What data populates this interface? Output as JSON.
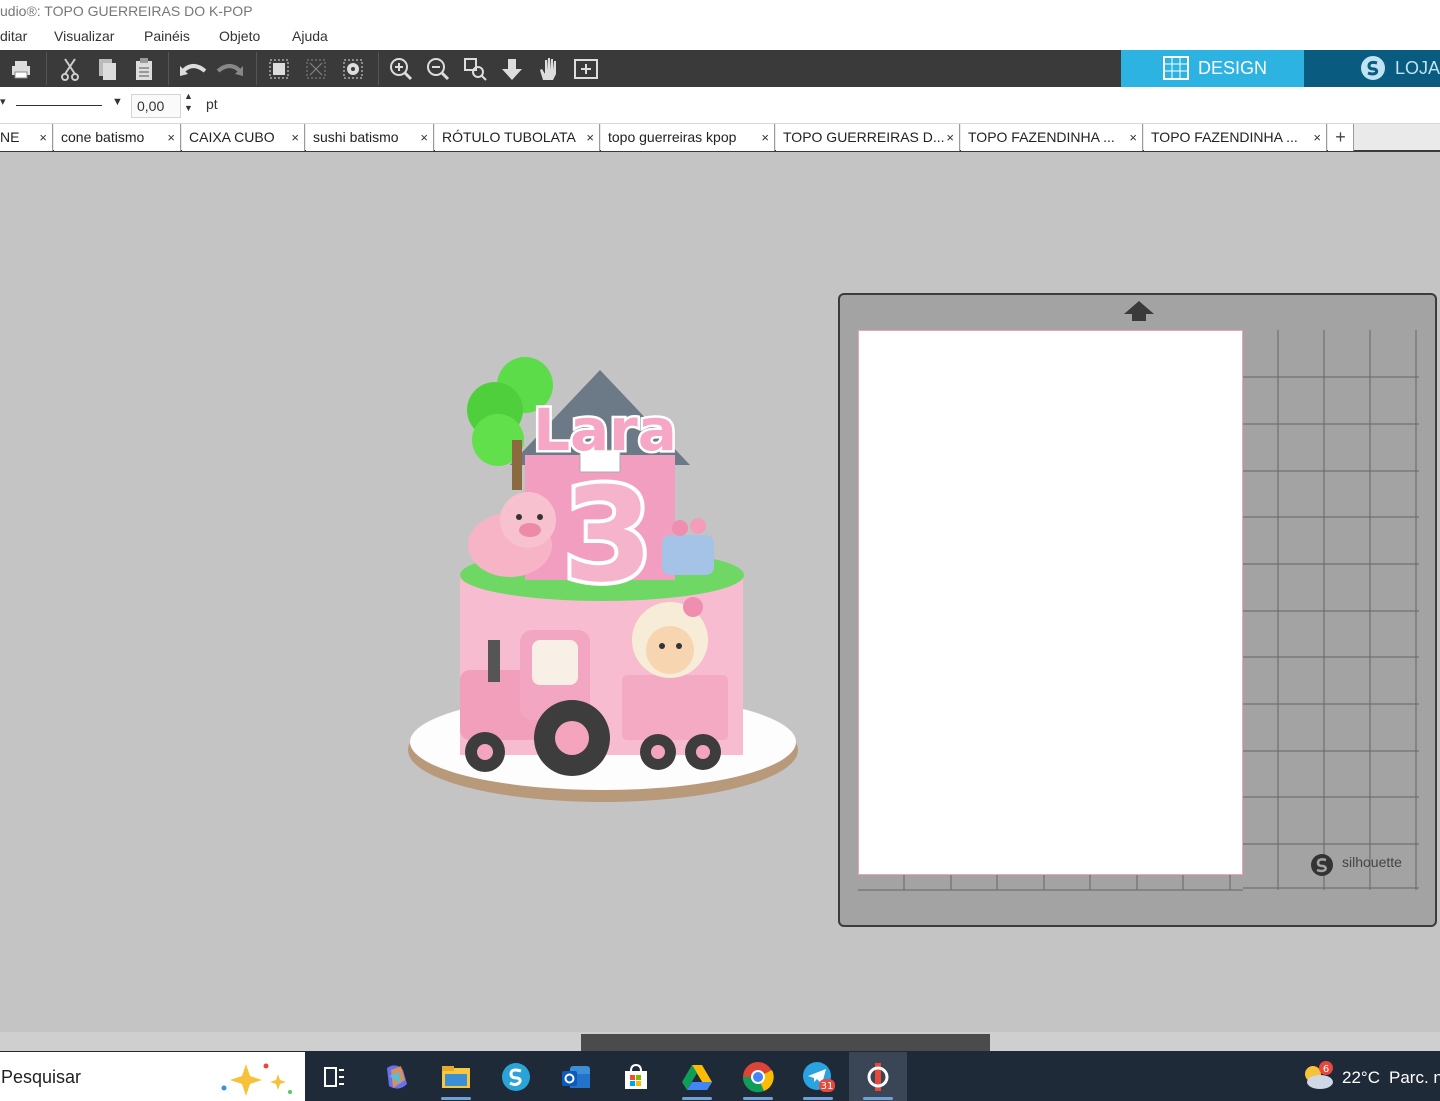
{
  "window": {
    "title": "udio®: TOPO GUERREIRAS DO K-POP"
  },
  "menu": [
    "ditar",
    "Visualizar",
    "Painéis",
    "Objeto",
    "Ajuda"
  ],
  "toolbar": {
    "design_label": "DESIGN",
    "store_label": "LOJA",
    "accent": "#2cb3e2"
  },
  "linebar": {
    "stroke_width": "0,00",
    "unit": "pt"
  },
  "tabs": [
    {
      "label": "NE"
    },
    {
      "label": "cone batismo"
    },
    {
      "label": "CAIXA CUBO"
    },
    {
      "label": "sushi batismo"
    },
    {
      "label": "RÓTULO TUBOLATA"
    },
    {
      "label": "topo guerreiras kpop"
    },
    {
      "label": "TOPO GUERREIRAS D..."
    },
    {
      "label": "TOPO FAZENDINHA ..."
    },
    {
      "label": "TOPO FAZENDINHA ..."
    }
  ],
  "tab_close": "×",
  "tab_add": "+",
  "canvas": {
    "cake_name": "Lara",
    "cake_number": "3",
    "mat_brand": "silhouette"
  },
  "taskbar": {
    "search_placeholder": "Pesquisar",
    "weather_temp": "22°C",
    "weather_text": "Parc. n",
    "weather_badge": "6",
    "telegram_badge": "31"
  }
}
